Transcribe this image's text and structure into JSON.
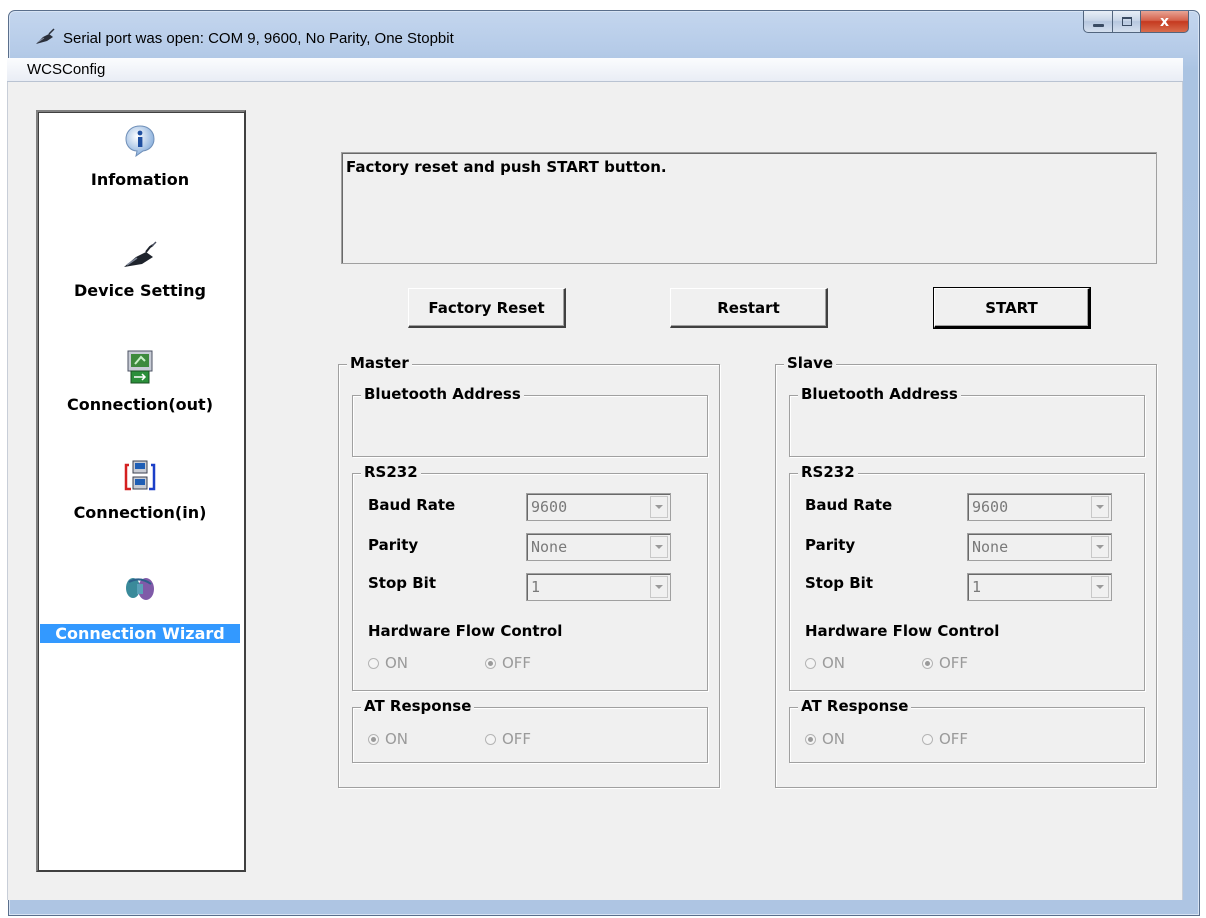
{
  "window": {
    "title": "Serial port was open: COM 9, 9600, No Parity, One Stopbit",
    "close_glyph": "x"
  },
  "menu": {
    "items": [
      "WCSConfig"
    ]
  },
  "sidebar": {
    "items": [
      {
        "label": "Infomation",
        "icon": "info-icon"
      },
      {
        "label": "Device Setting",
        "icon": "device-icon"
      },
      {
        "label": "Connection(out)",
        "icon": "connection-out-icon"
      },
      {
        "label": "Connection(in)",
        "icon": "connection-in-icon"
      },
      {
        "label": "Connection Wizard",
        "icon": "wizard-icon",
        "selected": true
      }
    ],
    "selected_color": "#3399ff"
  },
  "message": {
    "text": "Factory reset and push START button."
  },
  "buttons": {
    "factory_reset": "Factory Reset",
    "restart": "Restart",
    "start": "START"
  },
  "master": {
    "title": "Master",
    "bt_address": {
      "title": "Bluetooth Address",
      "value": ""
    },
    "rs232": {
      "title": "RS232",
      "baud_label": "Baud Rate",
      "baud_value": "9600",
      "parity_label": "Parity",
      "parity_value": "None",
      "stop_label": "Stop Bit",
      "stop_value": "1",
      "flow_label": "Hardware Flow Control",
      "flow_on": "ON",
      "flow_off": "OFF",
      "flow_selected": "OFF"
    },
    "at_response": {
      "title": "AT Response",
      "on": "ON",
      "off": "OFF",
      "selected": "ON"
    }
  },
  "slave": {
    "title": "Slave",
    "bt_address": {
      "title": "Bluetooth Address",
      "value": ""
    },
    "rs232": {
      "title": "RS232",
      "baud_label": "Baud Rate",
      "baud_value": "9600",
      "parity_label": "Parity",
      "parity_value": "None",
      "stop_label": "Stop Bit",
      "stop_value": "1",
      "flow_label": "Hardware Flow Control",
      "flow_on": "ON",
      "flow_off": "OFF",
      "flow_selected": "OFF"
    },
    "at_response": {
      "title": "AT Response",
      "on": "ON",
      "off": "OFF",
      "selected": "ON"
    }
  }
}
